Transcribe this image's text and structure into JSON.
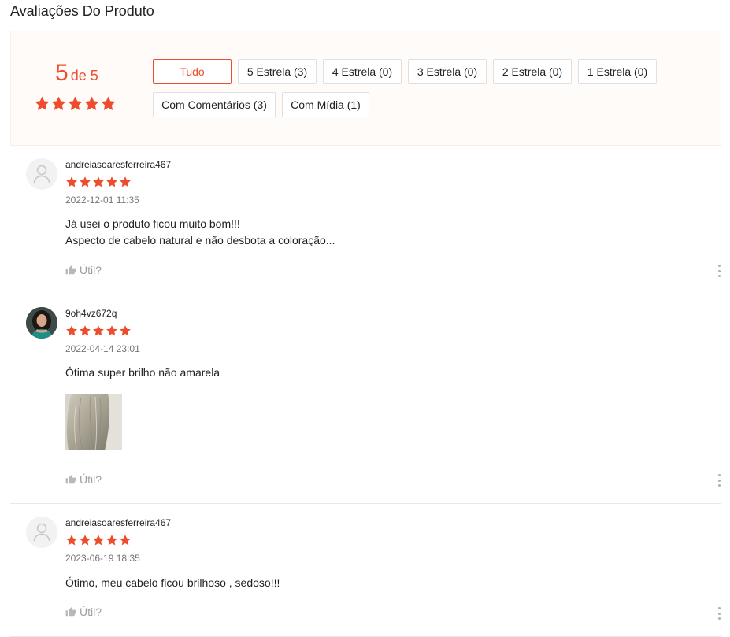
{
  "page_title": "Avaliações Do Produto",
  "summary": {
    "score": "5",
    "score_suffix": "de 5",
    "rating_value": 5,
    "rating_max": 5
  },
  "filters": [
    {
      "label": "Tudo",
      "active": true
    },
    {
      "label": "5 Estrela (3)",
      "active": false
    },
    {
      "label": "4 Estrela (0)",
      "active": false
    },
    {
      "label": "3 Estrela (0)",
      "active": false
    },
    {
      "label": "2 Estrela (0)",
      "active": false
    },
    {
      "label": "1 Estrela (0)",
      "active": false
    },
    {
      "label": "Com Comentários (3)",
      "active": false
    },
    {
      "label": "Com Mídia (1)",
      "active": false
    }
  ],
  "reviews": [
    {
      "username": "andreiasoaresferreira467",
      "rating": 5,
      "date": "2022-12-01 11:35",
      "text_lines": [
        "Já usei o produto ficou muito bom!!!",
        "Aspecto de cabelo natural e não desbota a coloração..."
      ],
      "useful_label": "Útil?",
      "avatar": "default-avatar-icon"
    },
    {
      "username": "9oh4vz672q",
      "rating": 5,
      "date": "2022-04-14 23:01",
      "text_lines": [
        "Ótima super brilho não amarela"
      ],
      "useful_label": "Útil?",
      "avatar": "photo"
    },
    {
      "username": "andreiasoaresferreira467",
      "rating": 5,
      "date": "2023-06-19 18:35",
      "text_lines": [
        "Ótimo, meu cabelo ficou brilhoso , sedoso!!!"
      ],
      "useful_label": "Útil?",
      "avatar": "default-avatar-icon"
    }
  ],
  "colors": {
    "accent": "#ee4d2d",
    "summary_bg": "#fffbf8",
    "muted_text": "#757575"
  }
}
